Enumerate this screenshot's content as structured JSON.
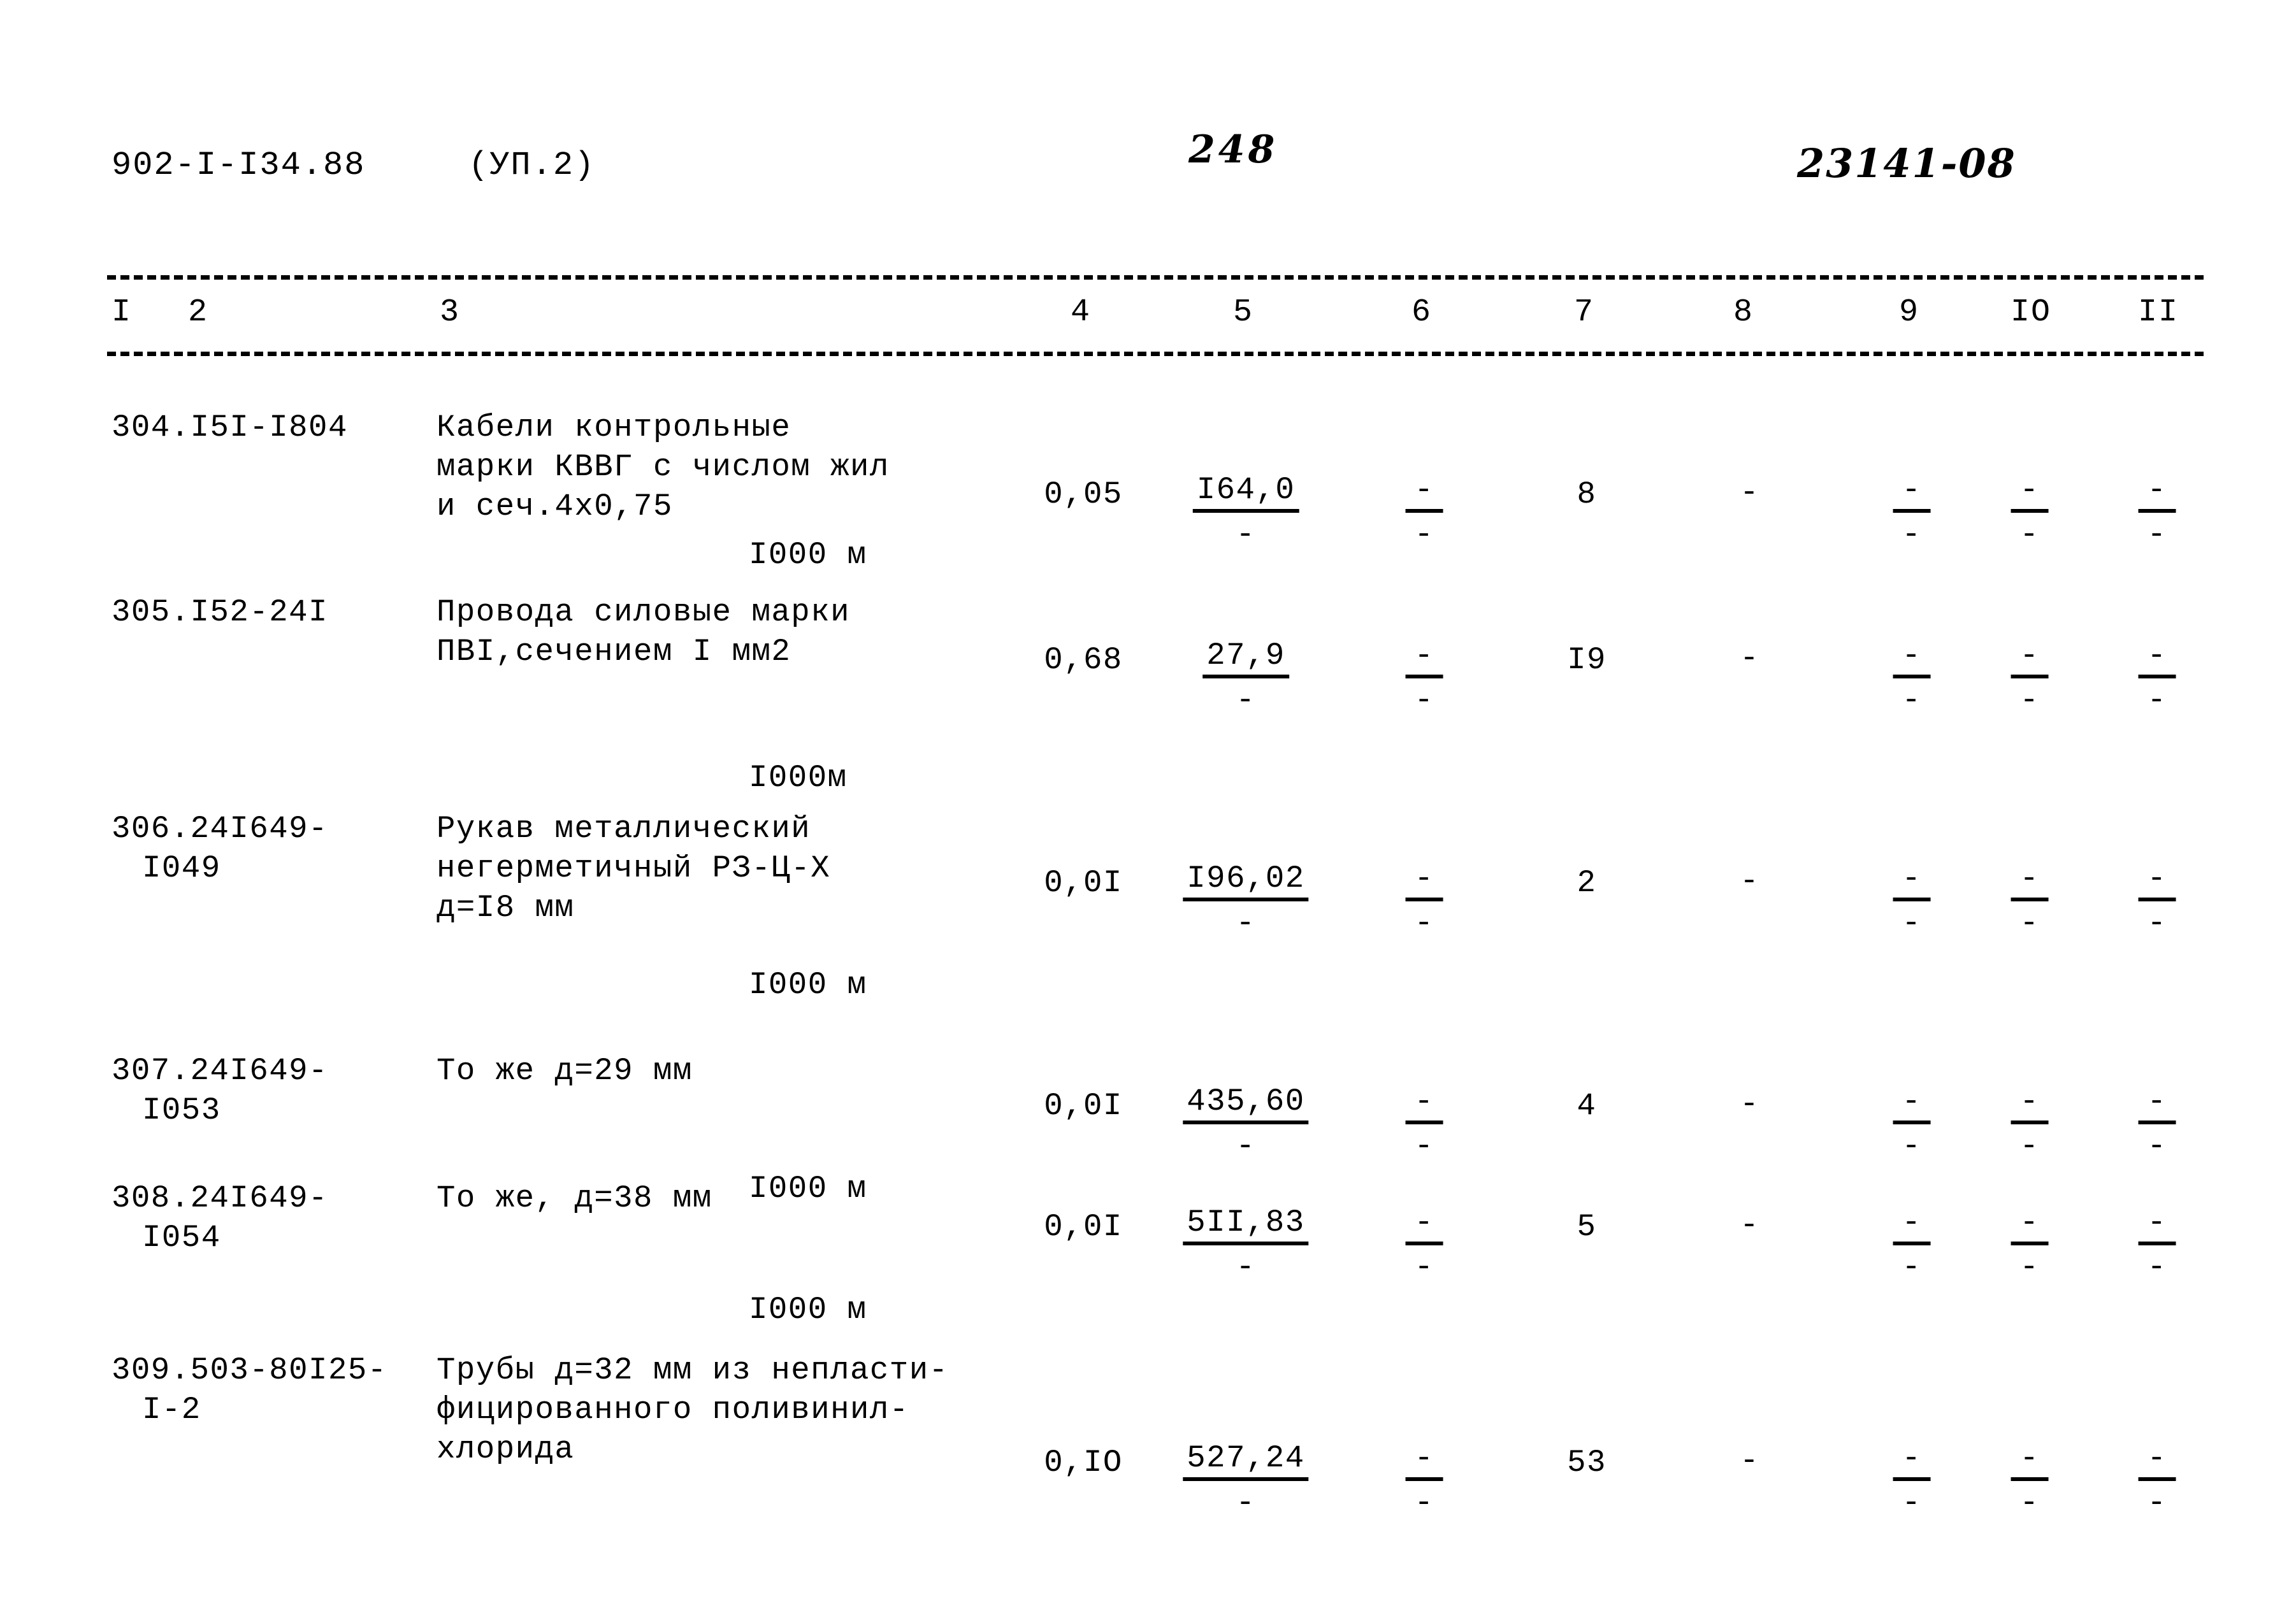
{
  "header": {
    "doc_code": "902-I-I34.88",
    "part": "(УП.2)",
    "page_number": "248",
    "stamp": "23141-08"
  },
  "table": {
    "column_headers": [
      "I",
      "2",
      "3",
      "4",
      "5",
      "6",
      "7",
      "8",
      "9",
      "IO",
      "II"
    ],
    "rows": [
      {
        "code_line1": "304.I5I-I804",
        "code_line2": "",
        "name": "Кабели контрольные\nмарки КВВГ с числом жил\nи сеч.4х0,75",
        "unit": "I000 м",
        "col4": "0,05",
        "col5_num": "I64,0",
        "col5_den": "-",
        "col6_num": "-",
        "col6_den": "-",
        "col7": "8",
        "col8": "-",
        "col9_num": "-",
        "col9_den": "-",
        "col10_num": "-",
        "col10_den": "-",
        "col11_num": "-",
        "col11_den": "-"
      },
      {
        "code_line1": "305.I52-24I",
        "code_line2": "",
        "name": "Провода силовые марки\nПВI,сечением I мм2",
        "unit": "I000м",
        "col4": "0,68",
        "col5_num": "27,9",
        "col5_den": "-",
        "col6_num": "-",
        "col6_den": "-",
        "col7": "I9",
        "col8": "-",
        "col9_num": "-",
        "col9_den": "-",
        "col10_num": "-",
        "col10_den": "-",
        "col11_num": "-",
        "col11_den": "-"
      },
      {
        "code_line1": "306.24I649-",
        "code_line2": "I049",
        "name": "Рукав металлический\nнегерметичный РЗ-Ц-Х\nд=I8 мм",
        "unit": "I000 м",
        "col4": "0,0I",
        "col5_num": "I96,02",
        "col5_den": "-",
        "col6_num": "-",
        "col6_den": "-",
        "col7": "2",
        "col8": "-",
        "col9_num": "-",
        "col9_den": "-",
        "col10_num": "-",
        "col10_den": "-",
        "col11_num": "-",
        "col11_den": "-"
      },
      {
        "code_line1": "307.24I649-",
        "code_line2": "I053",
        "name": "То же д=29 мм",
        "unit": "I000 м",
        "col4": "0,0I",
        "col5_num": "435,60",
        "col5_den": "-",
        "col6_num": "-",
        "col6_den": "-",
        "col7": "4",
        "col8": "-",
        "col9_num": "-",
        "col9_den": "-",
        "col10_num": "-",
        "col10_den": "-",
        "col11_num": "-",
        "col11_den": "-"
      },
      {
        "code_line1": "308.24I649-",
        "code_line2": "I054",
        "name": "То же, д=38 мм",
        "unit": "I000 м",
        "col4": "0,0I",
        "col5_num": "5II,83",
        "col5_den": "-",
        "col6_num": "-",
        "col6_den": "-",
        "col7": "5",
        "col8": "-",
        "col9_num": "-",
        "col9_den": "-",
        "col10_num": "-",
        "col10_den": "-",
        "col11_num": "-",
        "col11_den": "-"
      },
      {
        "code_line1": "309.503-80I25-",
        "code_line2": "I-2",
        "name": "Трубы д=32 мм из непласти-\nфицированного поливинил-\nхлорида",
        "unit": "",
        "col4": "0,IO",
        "col5_num": "527,24",
        "col5_den": "-",
        "col6_num": "-",
        "col6_den": "-",
        "col7": "53",
        "col8": "-",
        "col9_num": "-",
        "col9_den": "-",
        "col10_num": "-",
        "col10_den": "-",
        "col11_num": "-",
        "col11_den": "-"
      }
    ]
  },
  "layout": {
    "col_x": {
      "c4": 1700,
      "c5": 1955,
      "c6": 2235,
      "c7": 2490,
      "c8": 2745,
      "c9": 3000,
      "c10": 3185,
      "c11": 3385
    },
    "header_x": {
      "h1": 175,
      "h2": 295,
      "h3": 690,
      "h4": 1680,
      "h5": 1935,
      "h6": 2215,
      "h7": 2470,
      "h8": 2720,
      "h9": 2980,
      "h10": 3155,
      "h11": 3355
    },
    "row_tops": [
      40,
      330,
      670,
      1050,
      1250,
      1520
    ],
    "row_num_offsets": [
      105,
      75,
      85,
      55,
      45,
      145
    ],
    "row_unit_offsets": [
      200,
      260,
      245,
      185,
      175,
      0
    ]
  }
}
